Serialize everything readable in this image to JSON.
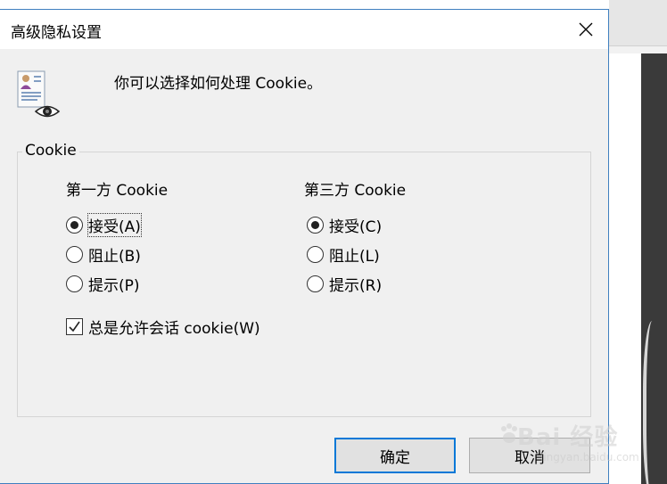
{
  "dialog": {
    "title": "高级隐私设置",
    "description": "你可以选择如何处理 Cookie。"
  },
  "group": {
    "label": "Cookie"
  },
  "first_party": {
    "heading": "第一方 Cookie",
    "options": [
      {
        "label": "接受(A)",
        "selected": true
      },
      {
        "label": "阻止(B)",
        "selected": false
      },
      {
        "label": "提示(P)",
        "selected": false
      }
    ]
  },
  "third_party": {
    "heading": "第三方 Cookie",
    "options": [
      {
        "label": "接受(C)",
        "selected": true
      },
      {
        "label": "阻止(L)",
        "selected": false
      },
      {
        "label": "提示(R)",
        "selected": false
      }
    ]
  },
  "session_checkbox": {
    "label": "总是允许会话 cookie(W)",
    "checked": true
  },
  "buttons": {
    "ok": "确定",
    "cancel": "取消"
  },
  "watermark": {
    "text": "Bai 经验",
    "sub": "jingyan.baidu.com"
  },
  "icons": {
    "privacy": "privacy-document-eye-icon",
    "close": "close-icon",
    "check": "check-icon"
  },
  "colors": {
    "accent": "#0078d7",
    "dialog_bg": "#f0f0f0",
    "window_border": "#3f7fbf"
  }
}
